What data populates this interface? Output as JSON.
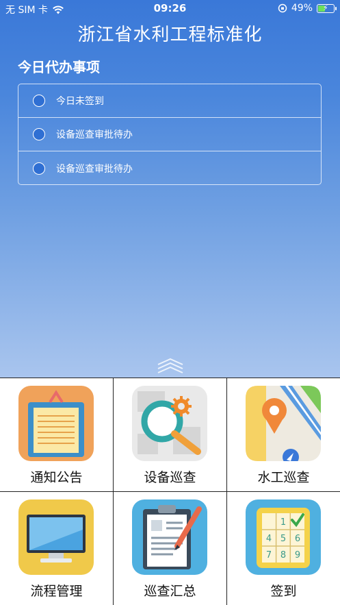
{
  "status_bar": {
    "carrier": "无 SIM 卡",
    "time": "09:26",
    "battery": "49%",
    "battery_level": 0.49
  },
  "header": {
    "title": "浙江省水利工程标准化"
  },
  "todo": {
    "heading": "今日代办事项",
    "items": [
      {
        "label": "今日未签到"
      },
      {
        "label": "设备巡查审批待办"
      },
      {
        "label": "设备巡查审批待办"
      }
    ]
  },
  "menu": {
    "items": [
      {
        "label": "通知公告",
        "icon": "clipboard-notice-icon"
      },
      {
        "label": "设备巡查",
        "icon": "magnifier-gear-icon"
      },
      {
        "label": "水工巡查",
        "icon": "map-pin-icon"
      },
      {
        "label": "流程管理",
        "icon": "monitor-icon"
      },
      {
        "label": "巡查汇总",
        "icon": "clipboard-pencil-icon"
      },
      {
        "label": "签到",
        "icon": "number-pad-check-icon"
      }
    ]
  },
  "colors": {
    "primary": "#3a78d8",
    "accent_orange": "#f0a25a"
  }
}
